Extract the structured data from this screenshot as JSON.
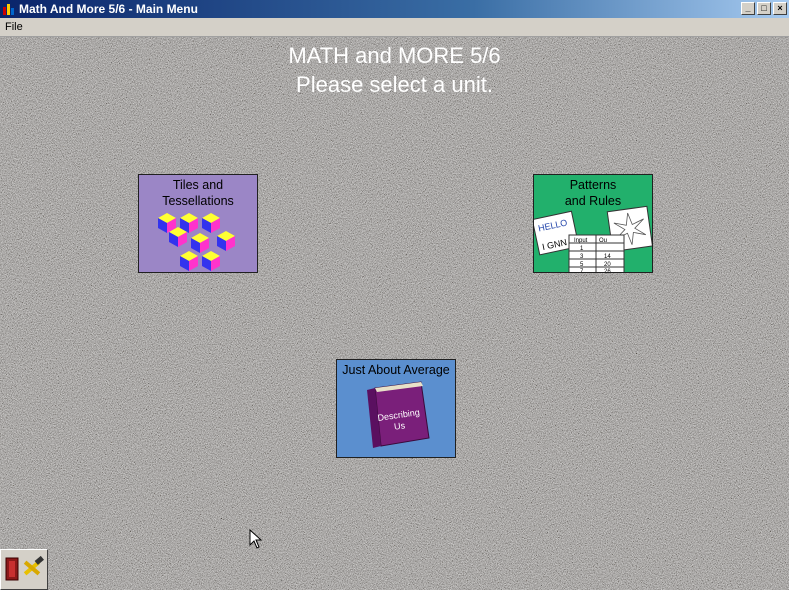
{
  "window": {
    "title": "Math And More 5/6 - Main Menu",
    "minimize_glyph": "_",
    "maximize_glyph": "□",
    "close_glyph": "×"
  },
  "menu": {
    "file_label": "File"
  },
  "main": {
    "heading_line1": "MATH and MORE 5/6",
    "heading_line2": "Please select a unit."
  },
  "units": {
    "tiles": {
      "label_line1": "Tiles and",
      "label_line2": "Tessellations",
      "color": "#9b86c6"
    },
    "patterns": {
      "label_line1": "Patterns",
      "label_line2": "and Rules",
      "color": "#22b06c",
      "card_text_1": "HELLO",
      "card_text_2": "I GNN",
      "table_headers": [
        "Input",
        "Ou"
      ],
      "table_rows": [
        [
          "1",
          ""
        ],
        [
          "3",
          "14"
        ],
        [
          "5",
          "20"
        ],
        [
          "7",
          "26"
        ]
      ]
    },
    "average": {
      "label": "Just About Average",
      "book_text_1": "Describing",
      "book_text_2": "Us",
      "color": "#5b8fcf"
    }
  },
  "icons": {
    "app": "app-icon",
    "exit": "exit-door-icon",
    "tools": "tools-icon"
  }
}
